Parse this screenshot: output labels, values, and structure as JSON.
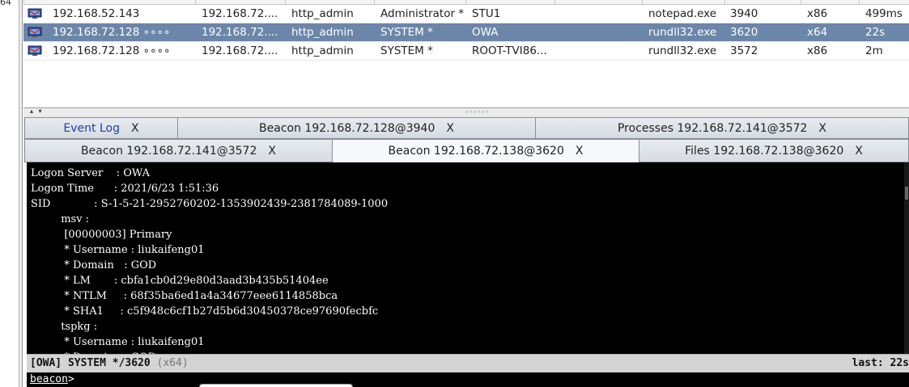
{
  "left_strip": {
    "fragment": "64"
  },
  "sessions": [
    {
      "external": "192.168.52.143",
      "internal": "192.168.72....",
      "listener": "http_admin",
      "user": "Administrator *",
      "computer": "STU1",
      "note": "",
      "process": "notepad.exe",
      "pid": "3940",
      "arch": "x86",
      "last": "499ms",
      "selected": false
    },
    {
      "external": "192.168.72.128 ∘∘∘∘",
      "internal": "192.168.72....",
      "listener": "http_admin",
      "user": "SYSTEM *",
      "computer": "OWA",
      "note": "",
      "process": "rundll32.exe",
      "pid": "3620",
      "arch": "x64",
      "last": "22s",
      "selected": true
    },
    {
      "external": "192.168.72.128 ∘∘∘∘",
      "internal": "192.168.72....",
      "listener": "http_admin",
      "user": "SYSTEM *",
      "computer": "ROOT-TVI86...",
      "note": "",
      "process": "rundll32.exe",
      "pid": "3572",
      "arch": "x86",
      "last": "2m",
      "selected": false
    }
  ],
  "splitter": {
    "arrows": "▴ ▾",
    "grip": "∘∘∘∘∘∘"
  },
  "tabs_row1": [
    {
      "label": "Event Log",
      "close": "X"
    },
    {
      "label": "Beacon 192.168.72.128@3940",
      "close": "X"
    },
    {
      "label": "Processes 192.168.72.141@3572",
      "close": "X"
    }
  ],
  "tabs_row2": [
    {
      "label": "Beacon 192.168.72.141@3572",
      "close": "X"
    },
    {
      "label": "Beacon 192.168.72.138@3620",
      "close": "X"
    },
    {
      "label": "Files 192.168.72.138@3620",
      "close": "X"
    }
  ],
  "console_lines": [
    "Logon Server    : OWA",
    "Logon Time      : 2021/6/23 1:51:36",
    "SID             : S-1-5-21-2952760202-1353902439-2381784089-1000",
    "         msv :",
    "          [00000003] Primary",
    "          * Username : liukaifeng01",
    "          * Domain   : GOD",
    "          * LM       : cbfa1cb0d29e80d3aad3b435b51404ee",
    "          * NTLM     : 68f35ba6ed1a4a34677eee6114858bca",
    "          * SHA1     : c5f948c6cf1b27d5b6d30450378ce97690fecbfc",
    "         tspkg :",
    "          * Username : liukaifeng01",
    "          * Domain   : GOD"
  ],
  "statusbar": {
    "left": "[OWA] SYSTEM */3620 ",
    "arch": "(x64)",
    "right": "last: 22s"
  },
  "prompt": {
    "label": "beacon",
    "symbol": ">"
  },
  "colors": {
    "selected_row": "#6b86a8",
    "console_bg": "#000000",
    "link_tab": "#1f3fb0"
  }
}
